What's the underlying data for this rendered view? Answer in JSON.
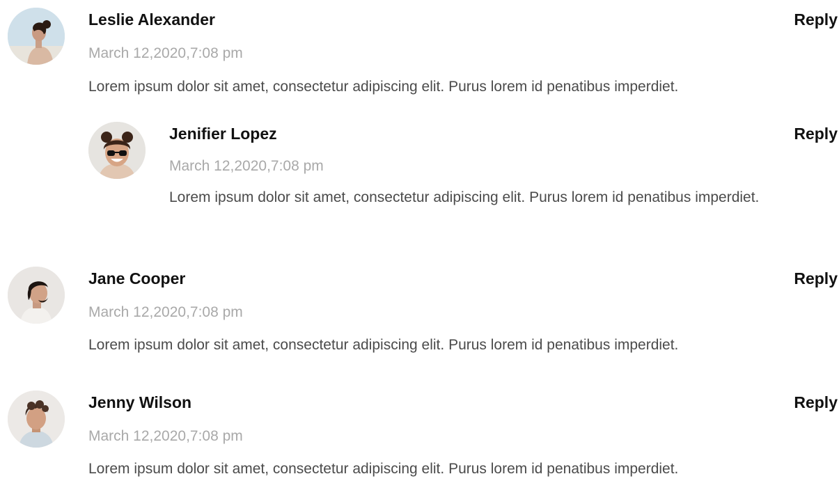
{
  "comments": [
    {
      "author": "Leslie Alexander",
      "date": "March 12,2020,7:08 pm",
      "text": "Lorem ipsum dolor sit amet, consectetur adipiscing elit. Purus lorem id penatibus imperdiet.",
      "reply_label": "Reply",
      "avatar_icon": "avatar-leslie-icon"
    },
    {
      "author": "Jenifier Lopez",
      "date": "March 12,2020,7:08 pm",
      "text": "Lorem ipsum dolor sit amet, consectetur adipiscing elit. Purus lorem id penatibus imperdiet.",
      "reply_label": "Reply",
      "avatar_icon": "avatar-jenifier-icon"
    },
    {
      "author": "Jane Cooper",
      "date": "March 12,2020,7:08 pm",
      "text": "Lorem ipsum dolor sit amet, consectetur adipiscing elit. Purus lorem id penatibus imperdiet.",
      "reply_label": "Reply",
      "avatar_icon": "avatar-jane-icon"
    },
    {
      "author": "Jenny Wilson",
      "date": "March 12,2020,7:08 pm",
      "text": "Lorem ipsum dolor sit amet, consectetur adipiscing elit. Purus lorem id penatibus imperdiet.",
      "reply_label": "Reply",
      "avatar_icon": "avatar-jenny-icon"
    }
  ],
  "colors": {
    "author": "#111111",
    "date": "#a9a9a9",
    "text": "#4b4b4b",
    "reply": "#111111"
  }
}
